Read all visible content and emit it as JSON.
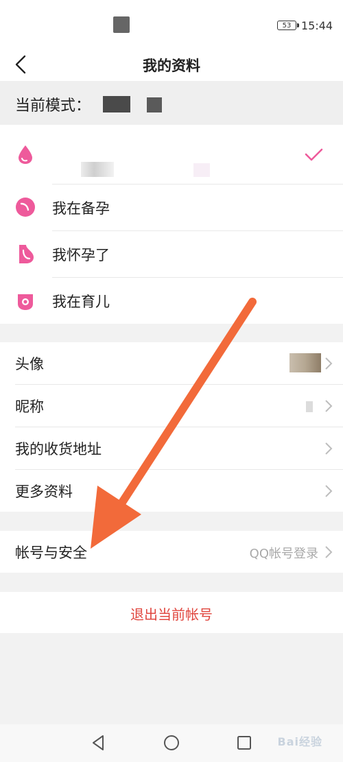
{
  "status_bar": {
    "battery": "53",
    "time": "15:44"
  },
  "header": {
    "title": "我的资料",
    "back_icon": "chevron-left-icon"
  },
  "mode": {
    "label": "当前模式："
  },
  "stages": [
    {
      "label": "",
      "icon": "drop-icon",
      "selected": true
    },
    {
      "label": "我在备孕",
      "icon": "seed-icon"
    },
    {
      "label": "我怀孕了",
      "icon": "pregnant-icon"
    },
    {
      "label": "我在育儿",
      "icon": "baby-icon"
    }
  ],
  "profile_menu": [
    {
      "label": "头像"
    },
    {
      "label": "昵称"
    },
    {
      "label": "我的收货地址"
    },
    {
      "label": "更多资料"
    }
  ],
  "account": {
    "label": "帐号与安全",
    "value": "QQ帐号登录"
  },
  "logout": {
    "label": "退出当前帐号"
  },
  "bottom_nav": [
    "back-triangle-icon",
    "home-circle-icon",
    "recent-square-icon"
  ],
  "watermark": "Bai经验",
  "colors": {
    "accent_pink": "#ee5a9b",
    "logout_red": "#e0463e",
    "arrow_orange": "#f26a3a"
  }
}
